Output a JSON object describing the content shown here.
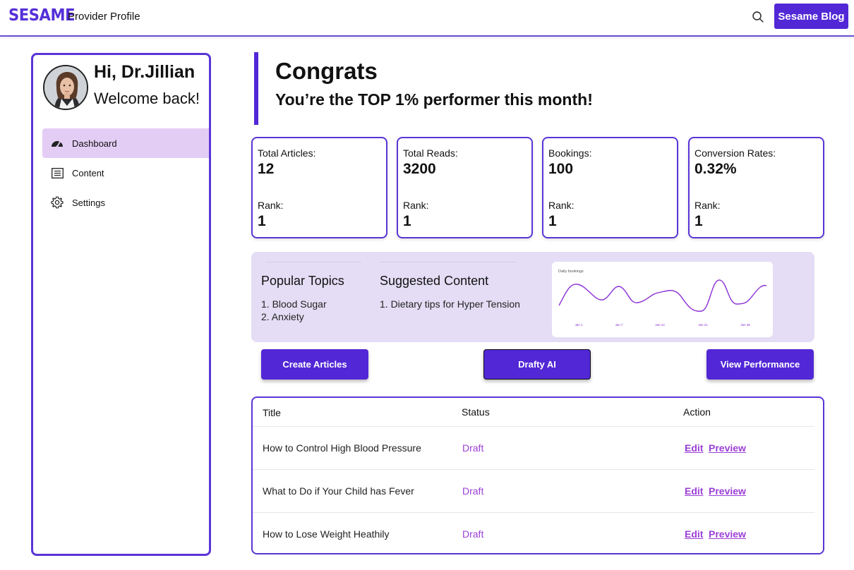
{
  "header": {
    "logo": "SESAME",
    "title": "Provider Profile",
    "search_icon": "search-icon",
    "blog_button": "Sesame Blog"
  },
  "sidebar": {
    "greeting": "Hi, Dr.Jillian",
    "welcome": "Welcome back!",
    "items": [
      {
        "label": "Dashboard",
        "icon": "dashboard-gauge-icon",
        "active": true
      },
      {
        "label": "Content",
        "icon": "content-list-icon",
        "active": false
      },
      {
        "label": "Settings",
        "icon": "gear-icon",
        "active": false
      }
    ]
  },
  "congrats": {
    "title": "Congrats",
    "subtitle": "You’re the TOP 1% performer this month!"
  },
  "stats": [
    {
      "label": "Total Articles:",
      "value": "12",
      "rank_label": "Rank:",
      "rank": "1"
    },
    {
      "label": "Total Reads:",
      "value": "3200",
      "rank_label": "Rank:",
      "rank": "1"
    },
    {
      "label": "Bookings:",
      "value": "100",
      "rank_label": "Rank:",
      "rank": "1"
    },
    {
      "label": "Conversion Rates:",
      "value": "0.32%",
      "rank_label": "Rank:",
      "rank": "1"
    }
  ],
  "popular_topics": {
    "title": "Popular Topics",
    "items": [
      "1.  Blood Sugar",
      "2. Anxiety"
    ]
  },
  "suggested_content": {
    "title": "Suggested Content",
    "items": [
      "1. Dietary tips for Hyper Tension"
    ]
  },
  "mini_chart": {
    "title": "Daily bookings",
    "x_ticks": [
      "Jan 1",
      "Jan 7",
      "Jan 14",
      "Jan 21",
      "Jan 28"
    ],
    "line_color": "#8a2fd6"
  },
  "actions": {
    "create": "Create Articles",
    "drafty": "Drafty  AI",
    "performance": "View Performance"
  },
  "table": {
    "headers": {
      "title": "Title",
      "status": "Status",
      "action": "Action"
    },
    "rows": [
      {
        "title": "How to Control High Blood Pressure",
        "status": "Draft",
        "edit": "Edit",
        "preview": "Preview"
      },
      {
        "title": "What to Do if Your Child has Fever",
        "status": "Draft",
        "edit": "Edit",
        "preview": "Preview"
      },
      {
        "title": "How to Lose Weight Heathily",
        "status": "Draft",
        "edit": "Edit",
        "preview": "Preview"
      }
    ]
  },
  "colors": {
    "brand": "#5227d6",
    "accent_text": "#9b3fd6",
    "active_nav": "#e4cdf5",
    "panel_bg": "#e4ddf5"
  }
}
